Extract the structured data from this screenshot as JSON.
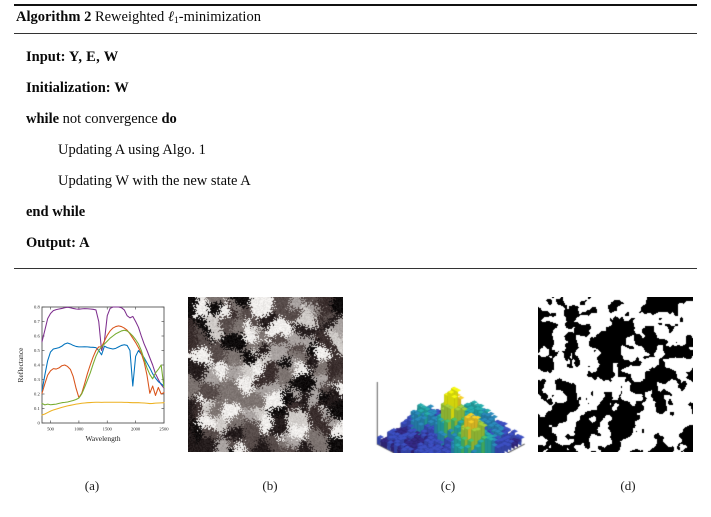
{
  "algorithm": {
    "header": {
      "label": "Algorithm",
      "number": "2",
      "title_prefix": "Reweighted ",
      "ell": "ℓ",
      "ell_sub": "1",
      "title_suffix": "-minimization"
    },
    "lines": [
      {
        "keyword": "Input:",
        "rest": " Y, E, W",
        "indent": false
      },
      {
        "keyword": "Initialization:",
        "rest": " W",
        "indent": false
      },
      {
        "keyword": "while",
        "rest": " not convergence ",
        "keyword2": "do",
        "indent": false
      },
      {
        "keyword": "",
        "rest": "Updating A using Algo. 1",
        "indent": true
      },
      {
        "keyword": "",
        "rest": "Updating W with the new state A",
        "indent": true
      },
      {
        "keyword": "end while",
        "rest": "",
        "indent": false
      },
      {
        "keyword": "Output:",
        "rest": " A",
        "indent": false
      }
    ],
    "line_texts": [
      "Input: Y, E, W",
      "Initialization: W",
      "while not convergence do",
      "Updating A using Algo. 1",
      "Updating W with the new state A",
      "end while",
      "Output: A"
    ]
  },
  "figure": {
    "captions": [
      {
        "id": "a",
        "text": "(a)"
      },
      {
        "id": "b",
        "text": "(b)"
      },
      {
        "id": "c",
        "text": "(c)"
      },
      {
        "id": "d",
        "text": "(d)"
      }
    ],
    "panel_b": {
      "description": "grayscale-brown-blob-texture",
      "palette": [
        "#f0eeec",
        "#cfcbc8",
        "#a9a3a1",
        "#7d7471",
        "#574c4a",
        "#3a2e2d",
        "#241c1c",
        "#0f0c0c"
      ],
      "blob_count": 150
    },
    "panel_c": {
      "description": "3d-surface-plot-parula",
      "colormap": [
        "#352a87",
        "#3d50c3",
        "#2b8cbe",
        "#27aeae",
        "#4bc46d",
        "#a6d13c",
        "#f9d229",
        "#f9fb0e"
      ],
      "grid": 22
    },
    "panel_d": {
      "description": "binary-black-white-map",
      "colors": [
        "#000000",
        "#ffffff"
      ],
      "threshold": 0.5
    }
  },
  "chart_data": {
    "type": "line",
    "title": "",
    "xlabel": "Wavelength",
    "ylabel": "Reflectance",
    "xlim": [
      350,
      2500
    ],
    "ylim": [
      0,
      0.8
    ],
    "xticks": [
      500,
      1000,
      1500,
      2000,
      2500
    ],
    "yticks": [
      0,
      0.1,
      0.2,
      0.3,
      0.4,
      0.5,
      0.6,
      0.7,
      0.8
    ],
    "grid": false,
    "legend": "none",
    "x": [
      350,
      400,
      450,
      500,
      550,
      600,
      650,
      700,
      750,
      800,
      850,
      900,
      950,
      1000,
      1050,
      1100,
      1150,
      1200,
      1250,
      1300,
      1350,
      1400,
      1450,
      1500,
      1550,
      1600,
      1650,
      1700,
      1750,
      1800,
      1850,
      1900,
      1950,
      2000,
      2050,
      2100,
      2150,
      2200,
      2250,
      2300,
      2350,
      2400,
      2450,
      2500
    ],
    "series": [
      {
        "name": "purple",
        "color": "#7E2F8E",
        "values": [
          0.56,
          0.64,
          0.72,
          0.755,
          0.775,
          0.782,
          0.786,
          0.79,
          0.795,
          0.798,
          0.795,
          0.79,
          0.786,
          0.785,
          0.787,
          0.789,
          0.788,
          0.786,
          0.784,
          0.78,
          0.7,
          0.5,
          0.565,
          0.74,
          0.79,
          0.8,
          0.8,
          0.8,
          0.795,
          0.78,
          0.74,
          0.725,
          0.735,
          0.7,
          0.66,
          0.6,
          0.545,
          0.5,
          0.45,
          0.4,
          0.34,
          0.3,
          0.265,
          0.24
        ]
      },
      {
        "name": "blue",
        "color": "#0072BD",
        "values": [
          0.22,
          0.33,
          0.43,
          0.49,
          0.51,
          0.515,
          0.52,
          0.53,
          0.545,
          0.552,
          0.545,
          0.535,
          0.528,
          0.525,
          0.525,
          0.526,
          0.525,
          0.523,
          0.522,
          0.52,
          0.5,
          0.47,
          0.53,
          0.52,
          0.515,
          0.51,
          0.515,
          0.525,
          0.535,
          0.54,
          0.535,
          0.5,
          0.255,
          0.46,
          0.5,
          0.475,
          0.45,
          0.415,
          0.38,
          0.34,
          0.31,
          0.285,
          0.27,
          0.255
        ]
      },
      {
        "name": "orange",
        "color": "#D95319",
        "values": [
          0.205,
          0.27,
          0.33,
          0.36,
          0.375,
          0.372,
          0.38,
          0.395,
          0.4,
          0.39,
          0.37,
          0.32,
          0.24,
          0.175,
          0.205,
          0.27,
          0.34,
          0.4,
          0.455,
          0.5,
          0.525,
          0.525,
          0.565,
          0.605,
          0.635,
          0.655,
          0.665,
          0.67,
          0.665,
          0.655,
          0.64,
          0.615,
          0.585,
          0.555,
          0.52,
          0.48,
          0.42,
          0.33,
          0.205,
          0.255,
          0.19,
          0.245,
          0.2,
          0.21
        ]
      },
      {
        "name": "green",
        "color": "#77AC30",
        "values": [
          0.135,
          0.125,
          0.13,
          0.126,
          0.128,
          0.13,
          0.135,
          0.14,
          0.142,
          0.145,
          0.15,
          0.155,
          0.162,
          0.172,
          0.2,
          0.245,
          0.295,
          0.345,
          0.405,
          0.46,
          0.5,
          0.525,
          0.545,
          0.565,
          0.585,
          0.6,
          0.615,
          0.625,
          0.635,
          0.64,
          0.635,
          0.62,
          0.6,
          0.575,
          0.545,
          0.5,
          0.44,
          0.38,
          0.335,
          0.305,
          0.345,
          0.37,
          0.4,
          0.245
        ]
      },
      {
        "name": "yellow",
        "color": "#EDB120",
        "values": [
          0.055,
          0.062,
          0.072,
          0.082,
          0.09,
          0.096,
          0.102,
          0.108,
          0.113,
          0.118,
          0.122,
          0.126,
          0.13,
          0.133,
          0.136,
          0.138,
          0.14,
          0.141,
          0.142,
          0.143,
          0.143,
          0.142,
          0.143,
          0.143,
          0.143,
          0.143,
          0.143,
          0.143,
          0.143,
          0.142,
          0.142,
          0.141,
          0.14,
          0.14,
          0.14,
          0.139,
          0.138,
          0.136,
          0.134,
          0.135,
          0.137,
          0.138,
          0.139,
          0.14
        ]
      }
    ]
  }
}
